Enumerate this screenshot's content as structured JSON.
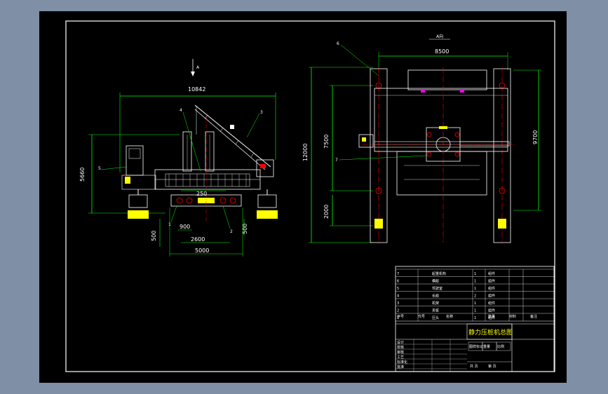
{
  "drawing": {
    "title": "静力压桩机总图",
    "view_label_side": "A",
    "view_label_top": "A向",
    "colors": {
      "background": "#000000",
      "frame": "#ffffff",
      "dimension": "#00ff00",
      "machine": "#ffffff",
      "accent_red": "#ff0000",
      "accent_yellow": "#ffff00",
      "accent_cyan": "#00ffff",
      "accent_magenta": "#ff00ff",
      "viewport_bg": "#7e8fa6"
    }
  },
  "side_view": {
    "dims": {
      "overall_length": "10842",
      "height": "5660",
      "pile_spacing": "250",
      "inner": "900",
      "mid": "2600",
      "bottom": "5000",
      "left_offset": "500",
      "right_offset": "500"
    },
    "callouts": [
      "1",
      "2",
      "3",
      "4",
      "5"
    ]
  },
  "top_view": {
    "dims": {
      "width": "8500",
      "total_length": "12000",
      "upper_length": "7500",
      "lower_length": "2000",
      "right_length": "9700"
    },
    "callouts": [
      "6",
      "7"
    ]
  },
  "title_block": {
    "parts_rows": [
      [
        "7",
        "起重机构",
        "1",
        "组件"
      ],
      [
        "6",
        "横船",
        "1",
        "组件"
      ],
      [
        "5",
        "驾驶室",
        "1",
        "组件"
      ],
      [
        "4",
        "长船",
        "2",
        "组件"
      ],
      [
        "3",
        "机架",
        "1",
        "组件"
      ],
      [
        "2",
        "夹桩",
        "1",
        "组件"
      ],
      [
        "1",
        "压头",
        "1",
        "组件"
      ]
    ],
    "header_row": [
      "序号",
      "代号",
      "名称",
      "数量",
      "材料",
      "备注"
    ],
    "sign_rows": [
      "设计",
      "校核",
      "审核",
      "工艺",
      "标准化",
      "批准"
    ],
    "right_cells": [
      "图样标记",
      "重量",
      "比例"
    ],
    "sheet_info": [
      "共 页",
      "第 页"
    ]
  }
}
